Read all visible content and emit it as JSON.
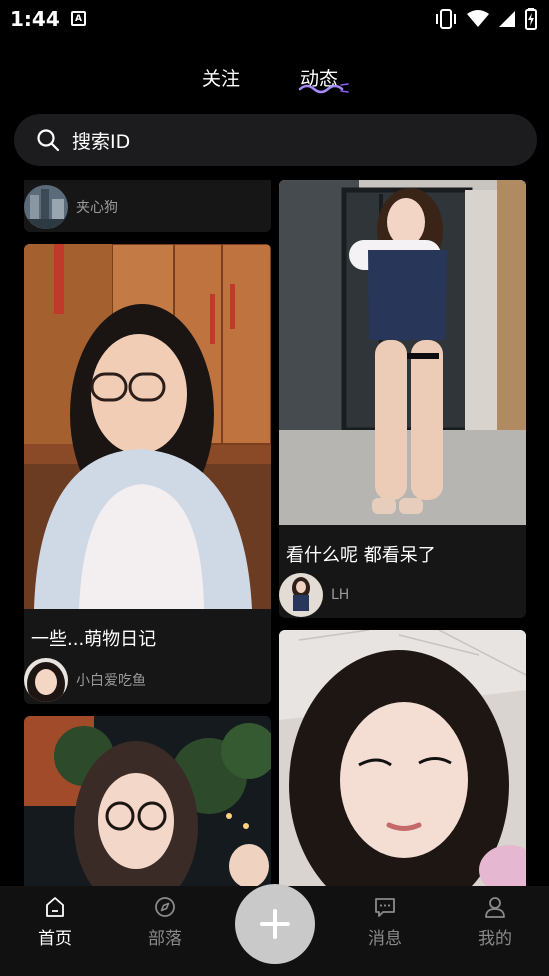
{
  "status_bar": {
    "time": "1:44",
    "notification_badge": "A"
  },
  "tabs": {
    "follow_label": "关注",
    "moments_label": "动态"
  },
  "search": {
    "placeholder": "搜索ID"
  },
  "feed": {
    "left": [
      {
        "author": "夹心狗"
      },
      {
        "caption": "一些...萌物日记",
        "author": "小白爱吃鱼"
      },
      {
        "caption": "",
        "author": ""
      }
    ],
    "right": [
      {
        "caption": "看什么呢 都看呆了",
        "author": "LH"
      },
      {
        "caption": "",
        "author": ""
      }
    ]
  },
  "bottom_nav": {
    "home_label": "首页",
    "tribe_label": "部落",
    "messages_label": "消息",
    "mine_label": "我的",
    "fab_icon": "plus-icon"
  },
  "colors": {
    "background": "#000000",
    "card_background": "#161616",
    "search_background": "#1c1c1e",
    "muted_text": "#9a9a9a",
    "fab_background": "#c9c9c9",
    "accent_underline": "#a78bfa"
  }
}
